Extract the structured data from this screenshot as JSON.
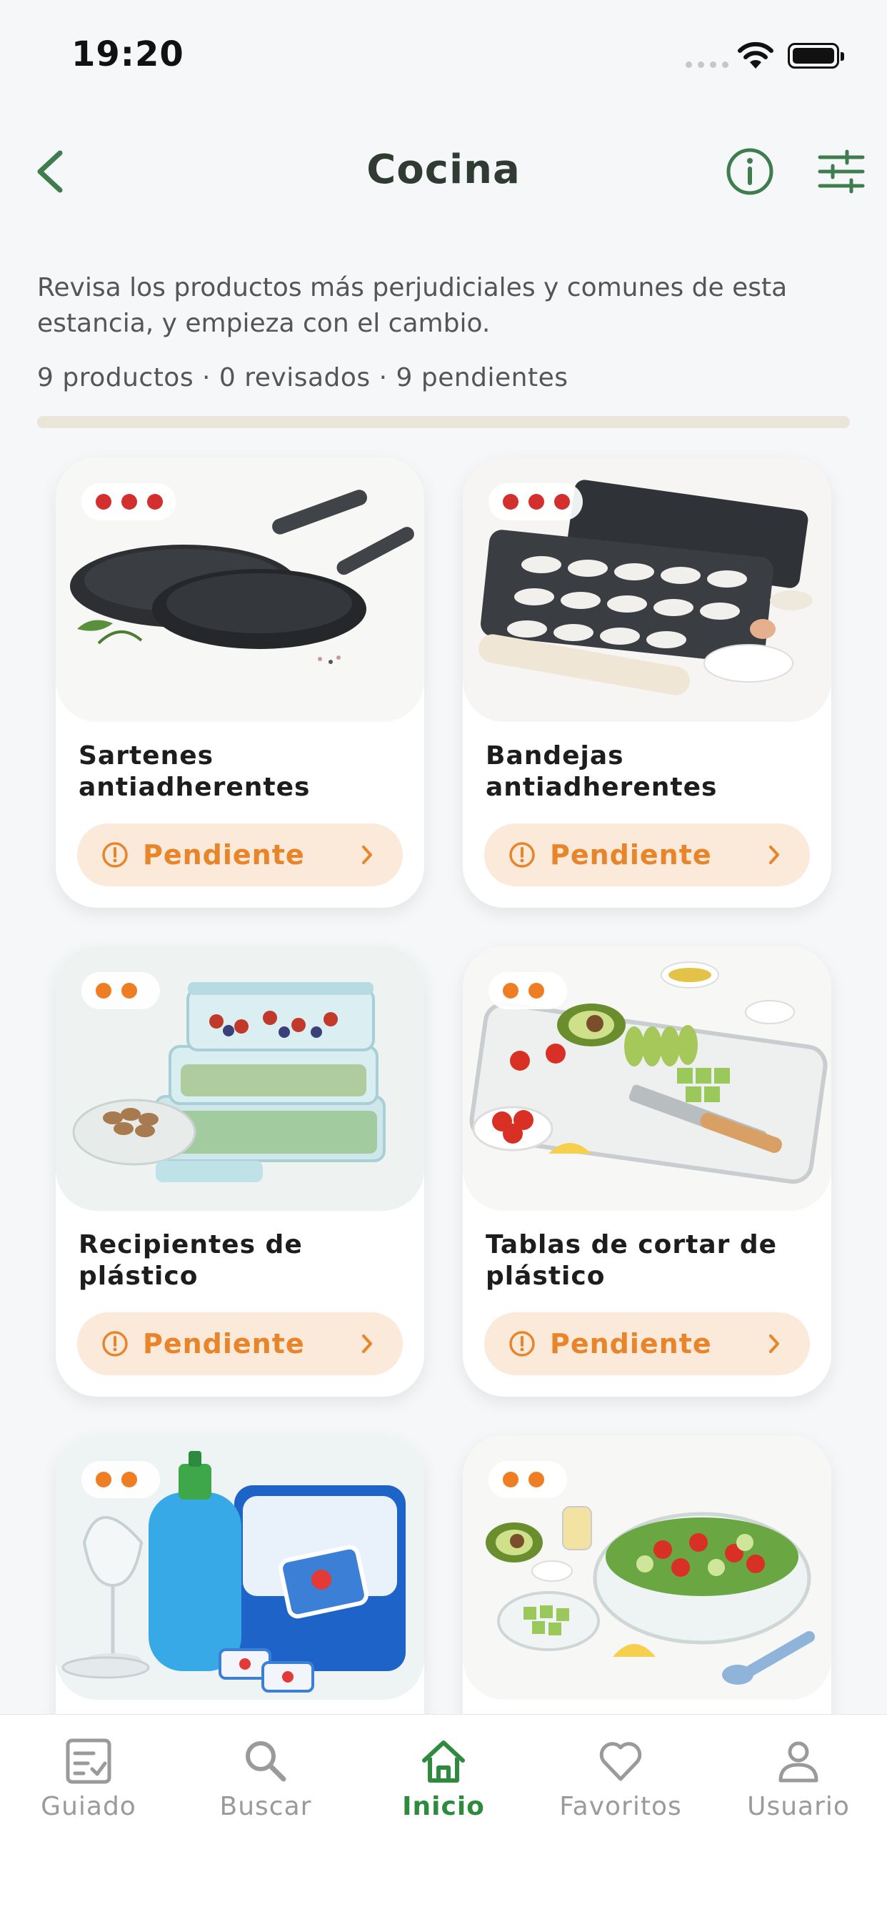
{
  "status_bar": {
    "time": "19:20"
  },
  "header": {
    "title": "Cocina"
  },
  "intro": {
    "description": "Revisa los productos más perjudiciales y comunes de esta estancia, y empieza con el cambio.",
    "counts": "9 productos · 0 revisados · 9 pendientes",
    "reviewed_fraction": 0
  },
  "colors": {
    "accent": "#2e8b3e",
    "pending": "#e8842a",
    "pending_bg": "#fbe9da",
    "danger_dot": "#d32f2f",
    "warning_dot": "#ef7d22"
  },
  "products": [
    {
      "name": "Sartenes antiadherentes",
      "status": "Pendiente",
      "severity": 3,
      "image": "frying-pans-image"
    },
    {
      "name": "Bandejas antiadherentes",
      "status": "Pendiente",
      "severity": 3,
      "image": "baking-trays-image"
    },
    {
      "name": "Recipientes de plástico",
      "status": "Pendiente",
      "severity": 2,
      "image": "plastic-containers-image"
    },
    {
      "name": "Tablas de cortar de plástico",
      "status": "Pendiente",
      "severity": 2,
      "image": "cutting-board-image"
    },
    {
      "name": "",
      "status": "",
      "severity": 2,
      "image": "dish-soap-image"
    },
    {
      "name": "",
      "status": "",
      "severity": 2,
      "image": "salad-bowl-image"
    }
  ],
  "tabbar": {
    "items": [
      {
        "label": "Guiado",
        "icon": "checklist-icon",
        "active": false
      },
      {
        "label": "Buscar",
        "icon": "search-icon",
        "active": false
      },
      {
        "label": "Inicio",
        "icon": "home-icon",
        "active": true
      },
      {
        "label": "Favoritos",
        "icon": "heart-icon",
        "active": false
      },
      {
        "label": "Usuario",
        "icon": "user-icon",
        "active": false
      }
    ]
  }
}
